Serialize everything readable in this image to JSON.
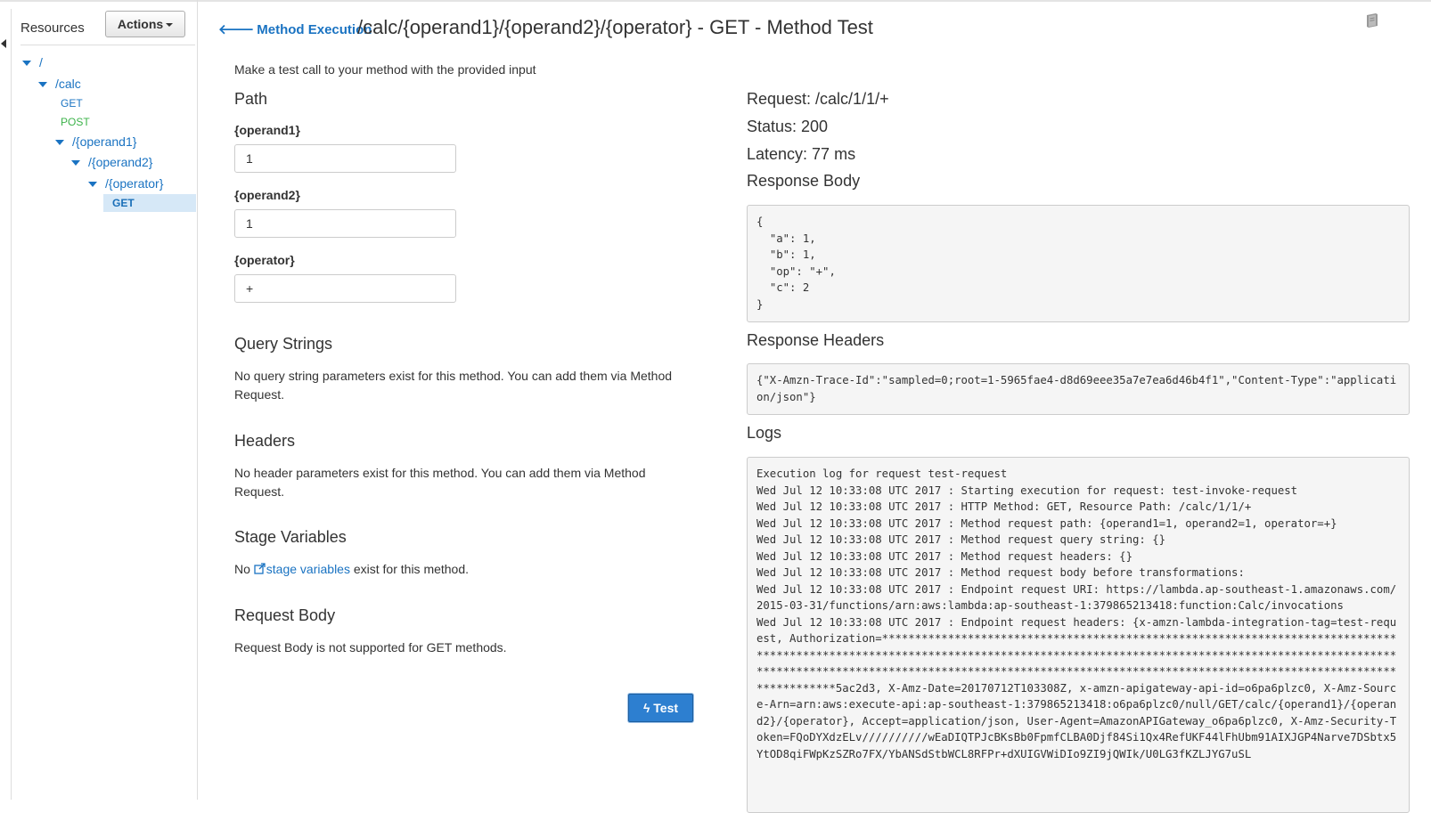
{
  "sidebar": {
    "title": "Resources",
    "actions_label": "Actions",
    "tree": {
      "root": "/",
      "calc": "/calc",
      "calc_get": "GET",
      "calc_post": "POST",
      "operand1": "/{operand1}",
      "operand2": "/{operand2}",
      "operator": "/{operator}",
      "operator_get": "GET"
    }
  },
  "header": {
    "back_label": "Method Execution",
    "title": "/calc/{operand1}/{operand2}/{operator} - GET - Method Test"
  },
  "form": {
    "intro": "Make a test call to your method with the provided input",
    "path_heading": "Path",
    "operand1_label": "{operand1}",
    "operand1_value": "1",
    "operand2_label": "{operand2}",
    "operand2_value": "1",
    "operator_label": "{operator}",
    "operator_value": "+",
    "query_heading": "Query Strings",
    "query_text": "No query string parameters exist for this method. You can add them via Method Request.",
    "headers_heading": "Headers",
    "headers_text": "No header parameters exist for this method. You can add them via Method Request.",
    "stage_heading": "Stage Variables",
    "stage_prefix": "No ",
    "stage_link": "stage variables",
    "stage_suffix": " exist for this method.",
    "body_heading": "Request Body",
    "body_text": "Request Body is not supported for GET methods.",
    "test_label": "Test"
  },
  "result": {
    "request": "Request: /calc/1/1/+",
    "status": "Status: 200",
    "latency": "Latency: 77 ms",
    "response_body_heading": "Response Body",
    "response_body": "{\n  \"a\": 1,\n  \"b\": 1,\n  \"op\": \"+\",\n  \"c\": 2\n}",
    "response_headers_heading": "Response Headers",
    "response_headers": "{\"X-Amzn-Trace-Id\":\"sampled=0;root=1-5965fae4-d8d69eee35a7e7ea6d46b4f1\",\"Content-Type\":\"application/json\"}",
    "logs_heading": "Logs",
    "logs": "Execution log for request test-request\nWed Jul 12 10:33:08 UTC 2017 : Starting execution for request: test-invoke-request\nWed Jul 12 10:33:08 UTC 2017 : HTTP Method: GET, Resource Path: /calc/1/1/+\nWed Jul 12 10:33:08 UTC 2017 : Method request path: {operand1=1, operand2=1, operator=+}\nWed Jul 12 10:33:08 UTC 2017 : Method request query string: {}\nWed Jul 12 10:33:08 UTC 2017 : Method request headers: {}\nWed Jul 12 10:33:08 UTC 2017 : Method request body before transformations:\nWed Jul 12 10:33:08 UTC 2017 : Endpoint request URI: https://lambda.ap-southeast-1.amazonaws.com/2015-03-31/functions/arn:aws:lambda:ap-southeast-1:379865213418:function:Calc/invocations\nWed Jul 12 10:33:08 UTC 2017 : Endpoint request headers: {x-amzn-lambda-integration-tag=test-request, Authorization=********************************************************************************************************************************************************************************************************************************************************************************************5ac2d3, X-Amz-Date=20170712T103308Z, x-amzn-apigateway-api-id=o6pa6plzc0, X-Amz-Source-Arn=arn:aws:execute-api:ap-southeast-1:379865213418:o6pa6plzc0/null/GET/calc/{operand1}/{operand2}/{operator}, Accept=application/json, User-Agent=AmazonAPIGateway_o6pa6plzc0, X-Amz-Security-Token=FQoDYXdzELv//////////wEaDIQTPJcBKsBb0FpmfCLBA0Djf84Si1Qx4RefUKF44lFhUbm91AIXJGP4Narve7DSbtx5YtOD8qiFWpKzSZRo7FX/YbANSdStbWCL8RFPr+dXUIGVWiDIo9ZI9jQWIk/U0LG3fKZLJYG7uSL"
  },
  "colors": {
    "link": "#1a73c2",
    "post": "#3cb34a",
    "button": "#2d7fd0",
    "selected": "#d6e8f7"
  }
}
